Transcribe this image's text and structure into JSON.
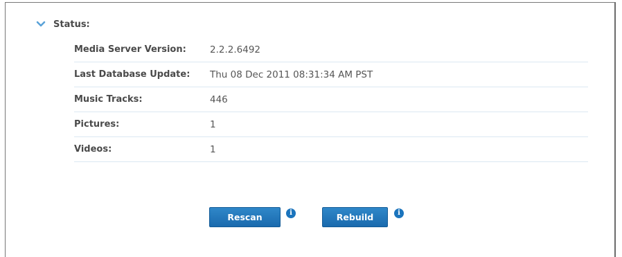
{
  "section": {
    "title": "Status:",
    "expanded_icon": "chevron-down-icon"
  },
  "rows": [
    {
      "label": "Media Server Version:",
      "value": "2.2.2.6492"
    },
    {
      "label": "Last Database Update:",
      "value": "Thu 08 Dec 2011 08:31:34 AM PST"
    },
    {
      "label": "Music Tracks:",
      "value": "446"
    },
    {
      "label": "Pictures:",
      "value": "1"
    },
    {
      "label": "Videos:",
      "value": "1"
    }
  ],
  "actions": {
    "rescan_label": "Rescan",
    "rebuild_label": "Rebuild",
    "info_glyph": "i",
    "info_icon": "info-icon"
  },
  "colors": {
    "accent": "#1b74bd",
    "button_top": "#2f87c9",
    "button_bottom": "#1a6aae",
    "row_divider": "#dbe8f2",
    "chevron": "#5aa2d8"
  }
}
